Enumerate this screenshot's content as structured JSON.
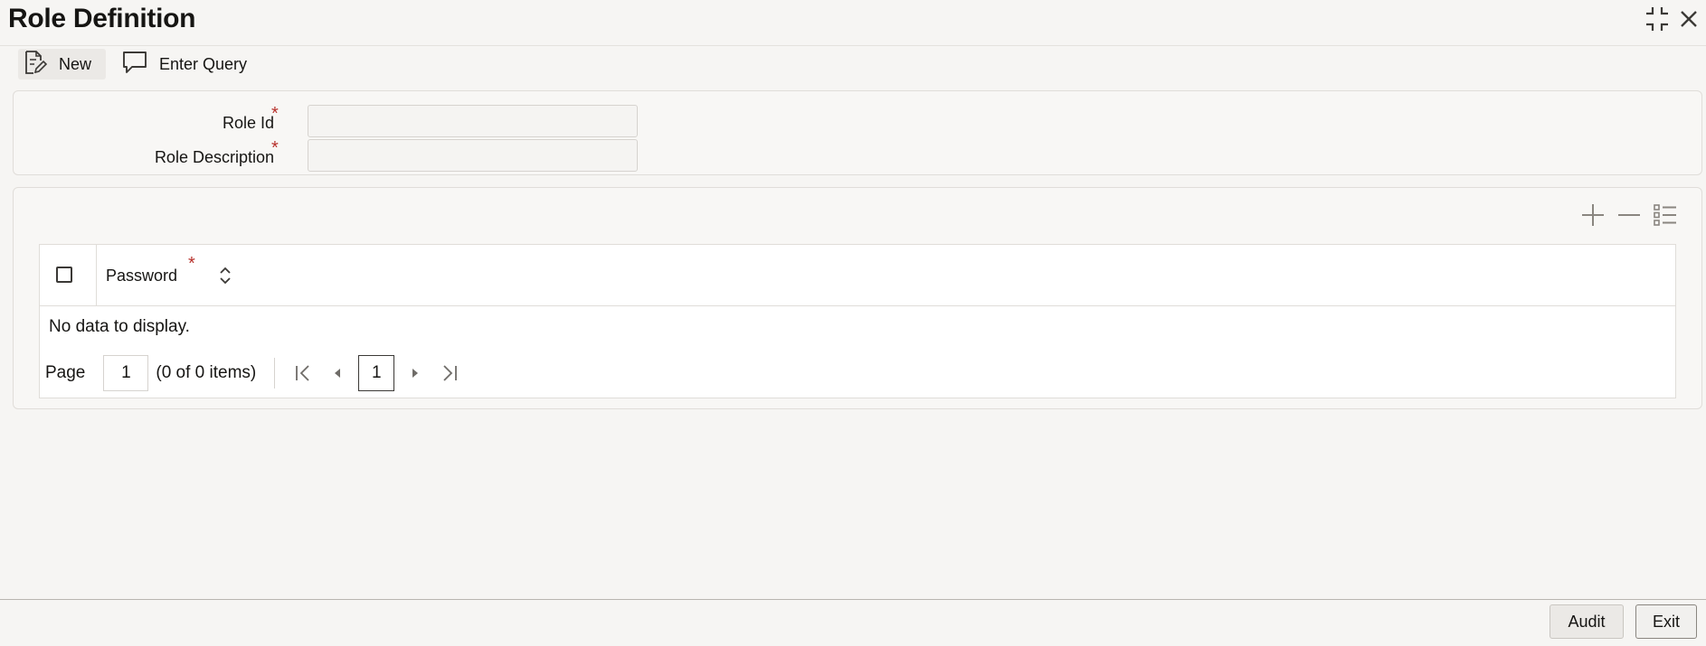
{
  "window": {
    "title": "Role Definition",
    "icons": [
      "minimize-icon",
      "close-icon"
    ]
  },
  "toolbar": {
    "new_label": "New",
    "enter_query_label": "Enter Query"
  },
  "form": {
    "role_id_label": "Role Id",
    "role_id_value": "",
    "role_description_label": "Role Description",
    "role_description_value": "",
    "required_marker": "*"
  },
  "grid": {
    "tools": [
      "add-row-icon",
      "delete-row-icon",
      "single-view-icon"
    ],
    "columns": [
      {
        "label": "Password",
        "required": true,
        "sortable": true
      }
    ],
    "rows": [],
    "empty_message": "No data to display."
  },
  "pagination": {
    "page_label": "Page",
    "page_input_value": "1",
    "items_count": "(0 of 0 items)",
    "current_page": "1"
  },
  "footer": {
    "audit_label": "Audit",
    "exit_label": "Exit"
  },
  "colors": {
    "required": "#b7312c",
    "background": "#f6f5f3",
    "panel": "#f8f7f5",
    "border": "#e0ddd9"
  }
}
